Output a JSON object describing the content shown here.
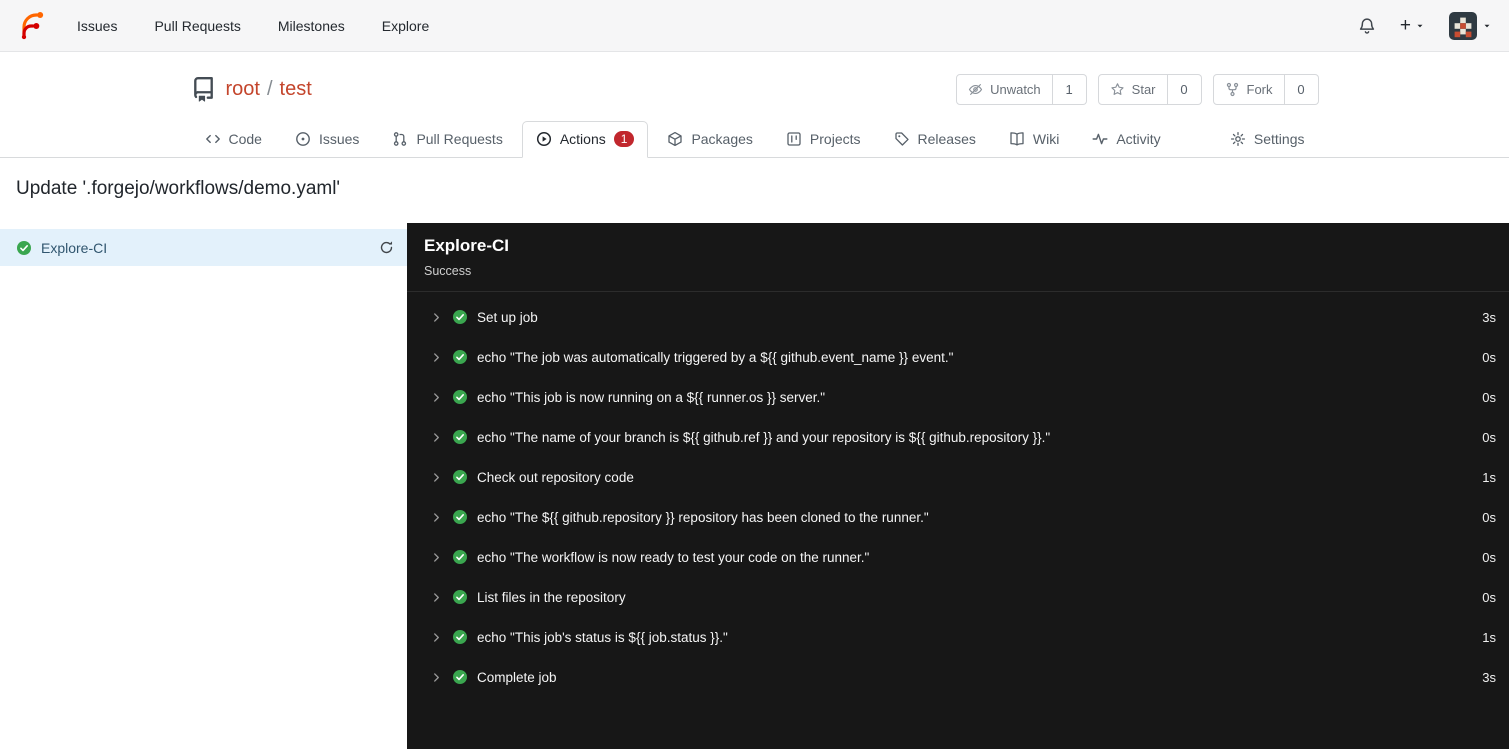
{
  "navbar": {
    "items": [
      "Issues",
      "Pull Requests",
      "Milestones",
      "Explore"
    ],
    "plus_label": "+"
  },
  "repo": {
    "owner": "root",
    "separator": "/",
    "name": "test",
    "buttons": [
      {
        "label": "Unwatch",
        "icon": "eye-slash-icon",
        "count": "1"
      },
      {
        "label": "Star",
        "icon": "star-icon",
        "count": "0"
      },
      {
        "label": "Fork",
        "icon": "fork-icon",
        "count": "0"
      }
    ]
  },
  "tabs": [
    {
      "label": "Code",
      "icon": "code-icon",
      "active": false
    },
    {
      "label": "Issues",
      "icon": "issue-icon",
      "active": false
    },
    {
      "label": "Pull Requests",
      "icon": "pull-request-icon",
      "active": false
    },
    {
      "label": "Actions",
      "icon": "play-circle-icon",
      "active": true,
      "badge": "1"
    },
    {
      "label": "Packages",
      "icon": "package-icon",
      "active": false
    },
    {
      "label": "Projects",
      "icon": "project-icon",
      "active": false
    },
    {
      "label": "Releases",
      "icon": "tag-icon",
      "active": false
    },
    {
      "label": "Wiki",
      "icon": "book-icon",
      "active": false
    },
    {
      "label": "Activity",
      "icon": "pulse-icon",
      "active": false
    }
  ],
  "settings_tab": {
    "label": "Settings",
    "icon": "gear-icon"
  },
  "page": {
    "title": "Update '.forgejo/workflows/demo.yaml'"
  },
  "sidebar": {
    "jobs": [
      {
        "name": "Explore-CI",
        "status": "success",
        "selected": true
      }
    ]
  },
  "job_panel": {
    "title": "Explore-CI",
    "status": "Success",
    "steps": [
      {
        "name": "Set up job",
        "duration": "3s"
      },
      {
        "name": "echo \"The job was automatically triggered by a ${{ github.event_name }} event.\"",
        "duration": "0s"
      },
      {
        "name": "echo \"This job is now running on a ${{ runner.os }} server.\"",
        "duration": "0s"
      },
      {
        "name": "echo \"The name of your branch is ${{ github.ref }} and your repository is ${{ github.repository }}.\"",
        "duration": "0s"
      },
      {
        "name": "Check out repository code",
        "duration": "1s"
      },
      {
        "name": "echo \"The ${{ github.repository }} repository has been cloned to the runner.\"",
        "duration": "0s"
      },
      {
        "name": "echo \"The workflow is now ready to test your code on the runner.\"",
        "duration": "0s"
      },
      {
        "name": "List files in the repository",
        "duration": "0s"
      },
      {
        "name": "echo \"This job's status is ${{ job.status }}.\"",
        "duration": "1s"
      },
      {
        "name": "Complete job",
        "duration": "3s"
      }
    ]
  },
  "colors": {
    "accent": "#c4452c",
    "success_green": "#3aa64f",
    "badge_red": "#c1272d",
    "selected_job_bg": "#e3f1fb",
    "panel_bg": "#171717"
  }
}
